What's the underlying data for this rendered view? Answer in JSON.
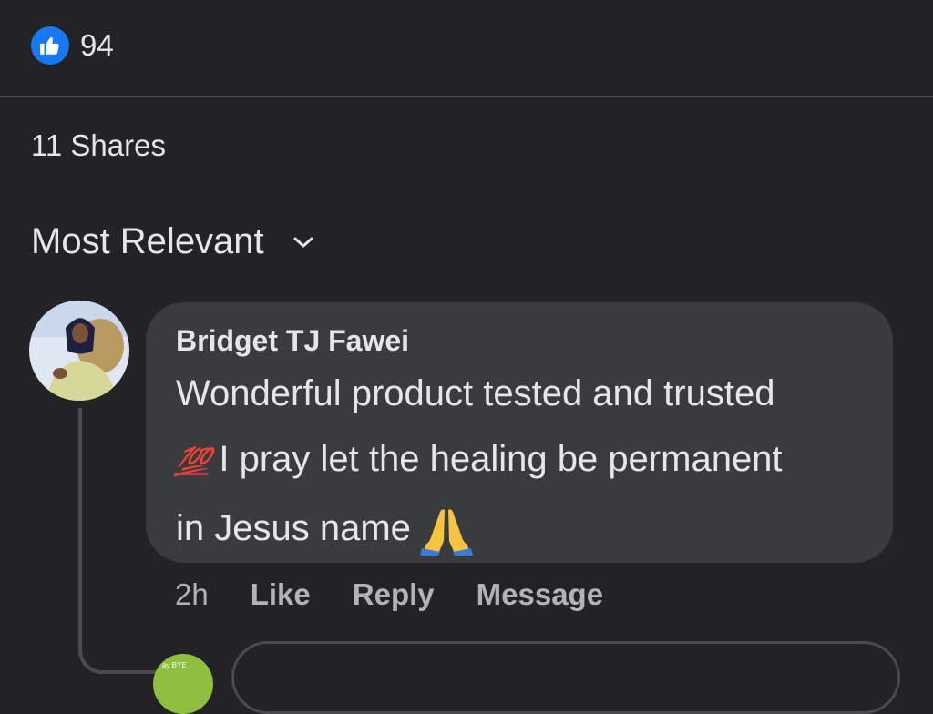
{
  "reactions": {
    "icon": "like-icon",
    "count": "94",
    "accent": "#1877f2"
  },
  "shares": {
    "label": "11 Shares"
  },
  "sort": {
    "label": "Most Relevant",
    "icon": "chevron-down-icon"
  },
  "comment": {
    "author": "Bridget TJ Fawei",
    "text_line1": "Wonderful product tested and trusted",
    "emoji_hundred": "💯",
    "text_line2": "I pray let the healing be permanent",
    "text_line3": "in Jesus name",
    "emoji_pray": "🙏",
    "time": "2h",
    "actions": {
      "like": "Like",
      "reply": "Reply",
      "message": "Message"
    }
  },
  "next_reply": {
    "avatar_text": "ay BYE"
  }
}
